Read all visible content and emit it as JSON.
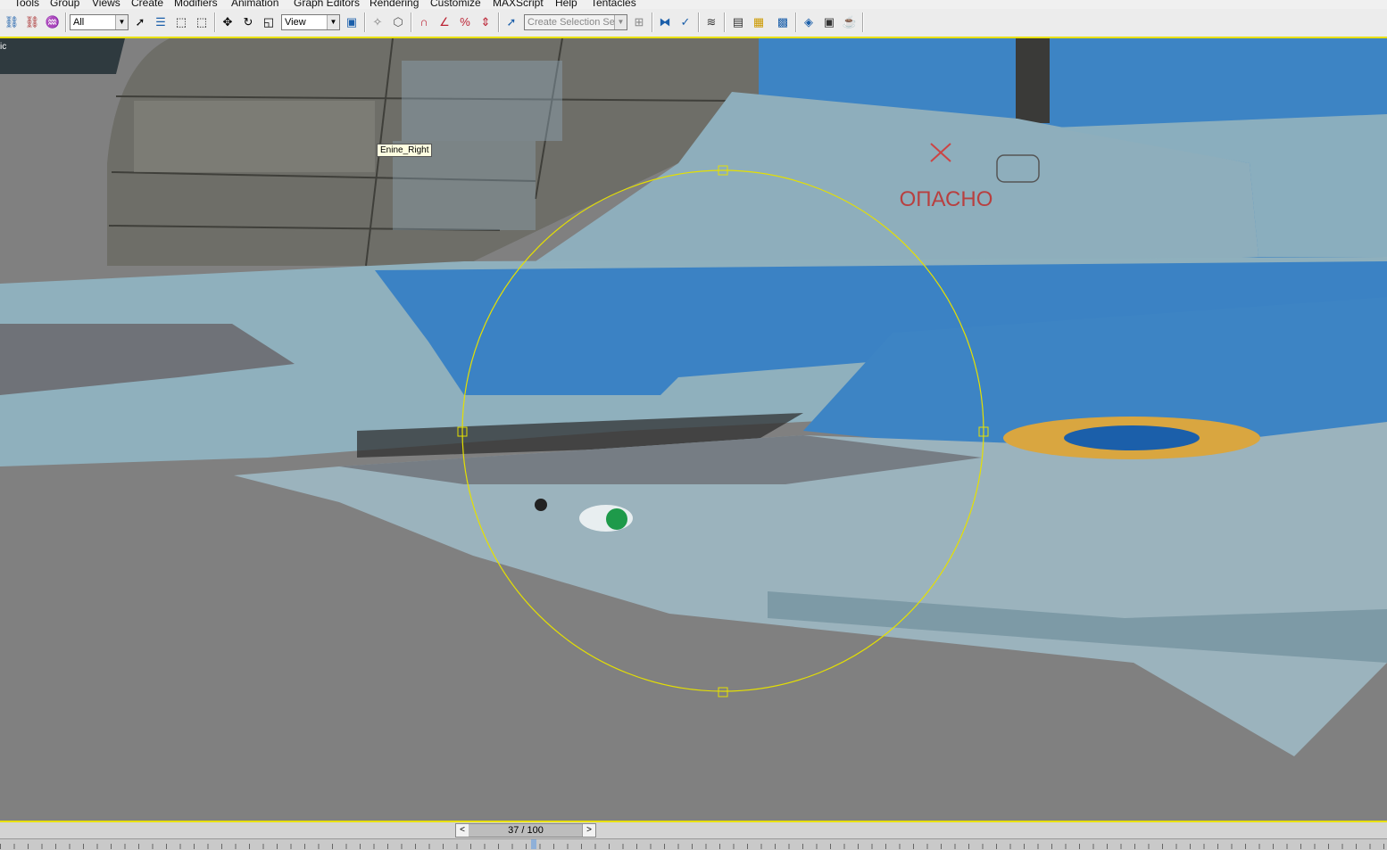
{
  "menu": [
    "Tools",
    "Group",
    "Views",
    "Create",
    "Modifiers",
    "Animation",
    "Graph Editors",
    "Rendering",
    "Customize",
    "MAXScript",
    "Help",
    "Tentacles"
  ],
  "toolbar": {
    "selection_filter": "All",
    "reference_coord": "View",
    "selection_set_placeholder": "Create Selection Set"
  },
  "viewport": {
    "label": "ic",
    "tooltip": "Enine_Right",
    "decal_text": "ОПАСНО",
    "colors": {
      "sky_blue": "#3b82c4",
      "light_grey_blue": "#8fb0bd",
      "roundel_yellow": "#d9a640",
      "roundel_blue": "#1b5faa",
      "gizmo": "#e5e000"
    }
  },
  "timeslider": {
    "label": "37 / 100",
    "prev": "<",
    "next": ">",
    "current_frame": 37,
    "total_frames": 100
  }
}
